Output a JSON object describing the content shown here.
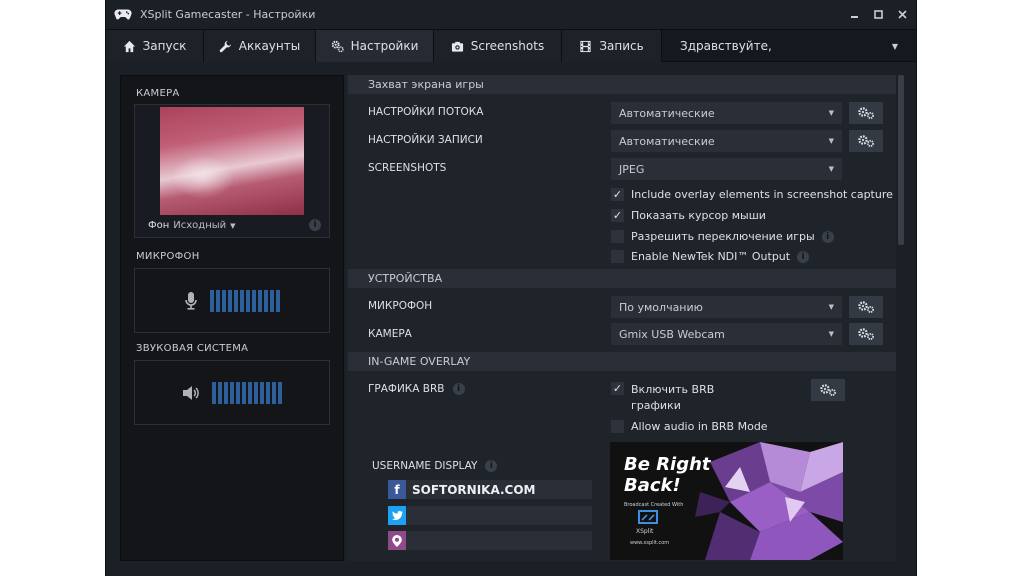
{
  "window": {
    "title": "XSplit Gamecaster - Настройки"
  },
  "tabs": [
    {
      "label": "Запуск",
      "icon": "home-icon"
    },
    {
      "label": "Аккаунты",
      "icon": "wrench-icon"
    },
    {
      "label": "Настройки",
      "icon": "gears-icon",
      "active": true
    },
    {
      "label": "Screenshots",
      "icon": "camera-icon"
    },
    {
      "label": "Запись",
      "icon": "film-icon"
    }
  ],
  "greeting": "Здравствуйте,",
  "left": {
    "camera_label": "КАМЕРА",
    "bg_label": "Фон",
    "bg_value": "Исходный",
    "mic_label": "МИКРОФОН",
    "sound_label": "ЗВУКОВАЯ СИСТЕМА"
  },
  "sections": {
    "capture": "Захват экрана игры",
    "devices": "УСТРОЙСТВА",
    "overlay": "IN-GAME OVERLAY"
  },
  "capture": {
    "stream_label": "НАСТРОЙКИ ПОТОКА",
    "stream_value": "Автоматические",
    "record_label": "НАСТРОЙКИ ЗАПИСИ",
    "record_value": "Автоматические",
    "screens_label": "SCREENSHOTS",
    "screens_value": "JPEG",
    "opt1": "Include overlay elements in screenshot capture",
    "opt2": "Показать курсор мыши",
    "opt3": "Разрешить переключение игры",
    "opt4": "Enable NewTek NDI™ Output"
  },
  "devices": {
    "mic_label": "МИКРОФОН",
    "mic_value": "По умолчанию",
    "cam_label": "КАМЕРА",
    "cam_value": "Gmix USB Webcam"
  },
  "overlay": {
    "brb_label": "ГРАФИКА BRB",
    "brb_enable_1": "Включить BRB",
    "brb_enable_2": "графики",
    "brb_audio": "Allow audio in BRB Mode",
    "username_label": "USERNAME DISPLAY",
    "facebook_value": "SOFTORNIKA.COM",
    "twitter_value": "",
    "periscope_value": "",
    "preview_title_1": "Be Right",
    "preview_title_2": "Back!",
    "preview_small": "Broadcast Created With",
    "preview_brand": "XSplit",
    "preview_url": "www.xsplit.com"
  },
  "colors": {
    "meter": "#2d5f9c",
    "facebook": "#3b5998",
    "twitter": "#1da1f2",
    "periscope": "#8e4a8b"
  }
}
